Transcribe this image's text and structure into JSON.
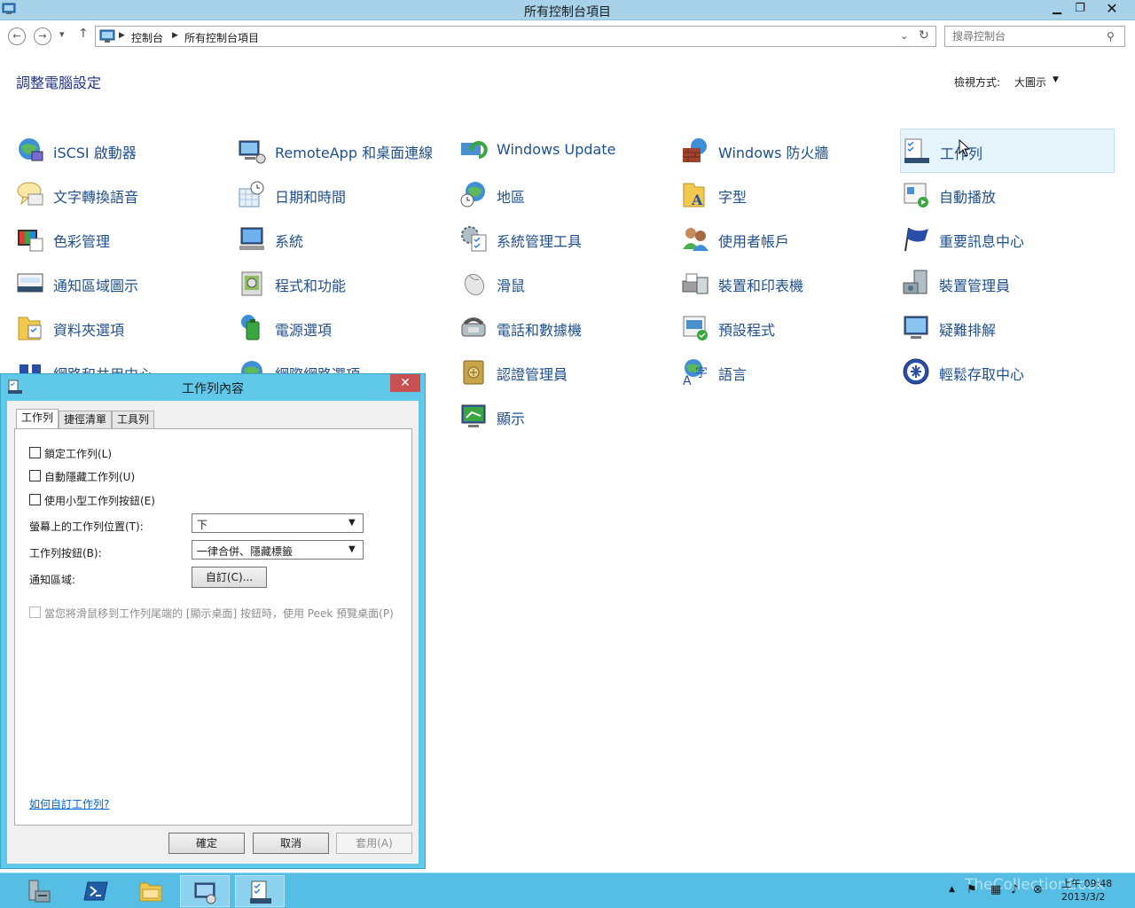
{
  "window": {
    "title": "所有控制台項目"
  },
  "address": {
    "crumbs": [
      "控制台",
      "所有控制台項目"
    ],
    "search_placeholder": "搜尋控制台"
  },
  "header": {
    "title": "調整電腦設定",
    "view_label": "檢視方式:",
    "view_value": "大圖示"
  },
  "items": [
    {
      "label": "iSCSI 啟動器"
    },
    {
      "label": "RemoteApp 和桌面連線"
    },
    {
      "label": "Windows Update"
    },
    {
      "label": "Windows 防火牆"
    },
    {
      "label": "工作列"
    },
    {
      "label": "文字轉換語音"
    },
    {
      "label": "日期和時間"
    },
    {
      "label": "地區"
    },
    {
      "label": "字型"
    },
    {
      "label": "自動播放"
    },
    {
      "label": "色彩管理"
    },
    {
      "label": "系統"
    },
    {
      "label": "系統管理工具"
    },
    {
      "label": "使用者帳戶"
    },
    {
      "label": "重要訊息中心"
    },
    {
      "label": "通知區域圖示"
    },
    {
      "label": "程式和功能"
    },
    {
      "label": "滑鼠"
    },
    {
      "label": "裝置和印表機"
    },
    {
      "label": "裝置管理員"
    },
    {
      "label": "資料夾選項"
    },
    {
      "label": "電源選項"
    },
    {
      "label": "電話和數據機"
    },
    {
      "label": "預設程式"
    },
    {
      "label": "疑難排解"
    },
    {
      "label": "網路和共用中心"
    },
    {
      "label": "網際網路選項"
    },
    {
      "label": "認證管理員"
    },
    {
      "label": "語言"
    },
    {
      "label": "輕鬆存取中心"
    },
    {
      "label": "顯示"
    }
  ],
  "dialog": {
    "title": "工作列內容",
    "tabs": [
      "工作列",
      "捷徑清單",
      "工具列"
    ],
    "checkboxes": [
      "鎖定工作列(L)",
      "自動隱藏工作列(U)",
      "使用小型工作列按鈕(E)"
    ],
    "position_label": "螢幕上的工作列位置(T):",
    "position_value": "下",
    "buttons_label": "工作列按鈕(B):",
    "buttons_value": "一律合併、隱藏標籤",
    "notify_label": "通知區域:",
    "customize_button": "自訂(C)...",
    "peek_label": "當您將滑鼠移到工作列尾端的 [顯示桌面] 按鈕時，使用 Peek 預覽桌面(P)",
    "help_link": "如何自訂工作列?",
    "ok": "確定",
    "cancel": "取消",
    "apply": "套用(A)"
  },
  "taskbar": {
    "time": "上午 09:48",
    "date": "2013/3/2",
    "watermark": "TheCollectionBook"
  }
}
